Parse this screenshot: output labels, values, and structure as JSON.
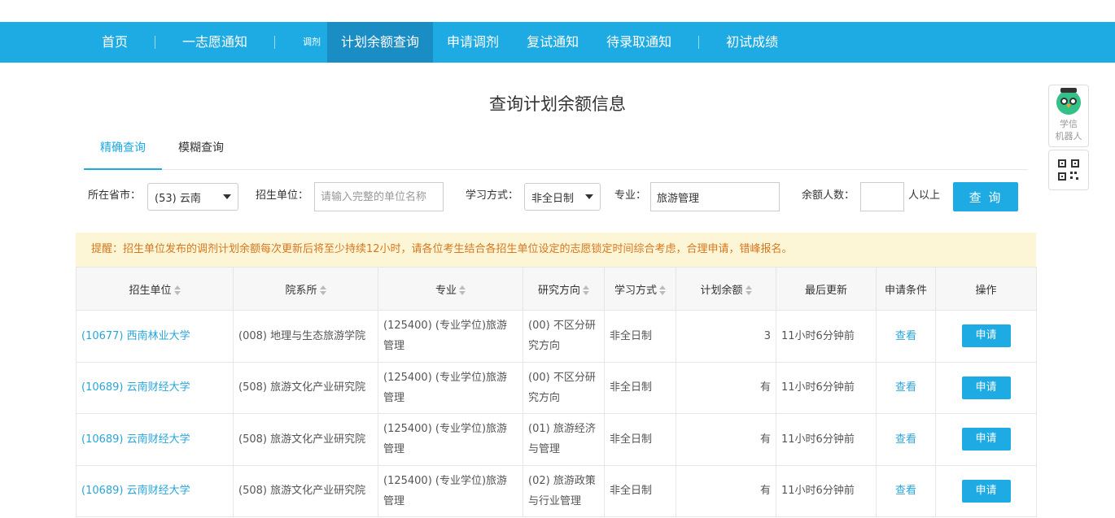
{
  "nav": {
    "items": [
      {
        "label": "首页"
      },
      {
        "label": "一志愿通知"
      },
      {
        "label": "调剂"
      },
      {
        "label": "计划余额查询"
      },
      {
        "label": "申请调剂"
      },
      {
        "label": "复试通知"
      },
      {
        "label": "待录取通知"
      },
      {
        "label": "初试成绩"
      }
    ],
    "active_index": 3
  },
  "page_title": "查询计划余额信息",
  "tabs": [
    {
      "label": "精确查询",
      "active": true
    },
    {
      "label": "模糊查询",
      "active": false
    }
  ],
  "filters": {
    "province_label": "所在省市：",
    "province_value": "(53) 云南",
    "unit_label": "招生单位：",
    "unit_placeholder": "请输入完整的单位名称",
    "mode_label": "学习方式：",
    "mode_value": "非全日制",
    "major_label": "专业：",
    "major_value": "旅游管理",
    "quota_label": "余额人数：",
    "quota_value": "",
    "quota_suffix": "人以上",
    "search_label": "查 询"
  },
  "notice": "提醒：招生单位发布的调剂计划余额每次更新后将至少持续12小时，请各位考生结合各招生单位设定的志愿锁定时间综合考虑，合理申请，错峰报名。",
  "table": {
    "headers": [
      "招生单位",
      "院系所",
      "专业",
      "研究方向",
      "学习方式",
      "计划余额",
      "最后更新",
      "申请条件",
      "操作"
    ],
    "view_label": "查看",
    "apply_label": "申请",
    "rows": [
      {
        "unit": "(10677) 西南林业大学",
        "dept": "(008) 地理与生态旅游学院",
        "major": "(125400) (专业学位)旅游管理",
        "direction": "(00) 不区分研究方向",
        "mode": "非全日制",
        "quota": "3",
        "updated": "11小时6分钟前"
      },
      {
        "unit": "(10689) 云南财经大学",
        "dept": "(508) 旅游文化产业研究院",
        "major": "(125400) (专业学位)旅游管理",
        "direction": "(00) 不区分研究方向",
        "mode": "非全日制",
        "quota": "有",
        "updated": "11小时6分钟前"
      },
      {
        "unit": "(10689) 云南财经大学",
        "dept": "(508) 旅游文化产业研究院",
        "major": "(125400) (专业学位)旅游管理",
        "direction": "(01) 旅游经济与管理",
        "mode": "非全日制",
        "quota": "有",
        "updated": "11小时6分钟前"
      },
      {
        "unit": "(10689) 云南财经大学",
        "dept": "(508) 旅游文化产业研究院",
        "major": "(125400) (专业学位)旅游管理",
        "direction": "(02) 旅游政策与行业管理",
        "mode": "非全日制",
        "quota": "有",
        "updated": "11小时6分钟前"
      }
    ]
  },
  "float": {
    "robot_line1": "学信",
    "robot_line2": "机器人",
    "robot_icon": "owl-robot-icon",
    "qr_icon": "qr-code-icon"
  },
  "colors": {
    "primary": "#1eabe3",
    "nav_active": "#1a8ec4",
    "notice_bg": "#fcf6d6",
    "notice_text": "#d8761e",
    "link": "#2ba5d9"
  }
}
